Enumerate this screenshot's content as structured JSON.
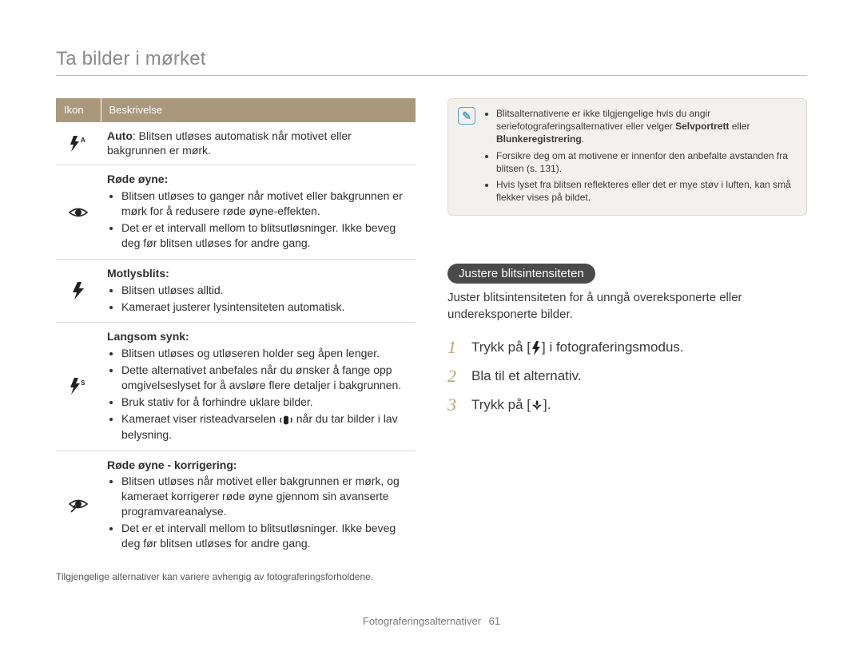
{
  "page_title": "Ta bilder i mørket",
  "table": {
    "head": {
      "icon": "Ikon",
      "desc": "Beskrivelse"
    },
    "rows": [
      {
        "icon_name": "flash-auto-icon",
        "title_bold": "Auto",
        "title_rest": ": Blitsen utløses automatisk når motivet eller bakgrunnen er mørk."
      },
      {
        "icon_name": "red-eye-icon",
        "title": "Røde øyne:",
        "bullets": [
          "Blitsen utløses to ganger når motivet eller bakgrunnen er mørk for å redusere røde øyne-effekten.",
          "Det er et intervall mellom to blitsutløsninger. Ikke beveg deg før blitsen utløses for andre gang."
        ]
      },
      {
        "icon_name": "fill-flash-icon",
        "title": "Motlysblits:",
        "bullets": [
          "Blitsen utløses alltid.",
          "Kameraet justerer lysintensiteten automatisk."
        ]
      },
      {
        "icon_name": "slow-sync-icon",
        "title": "Langsom synk:",
        "bullets": [
          "Blitsen utløses og utløseren holder seg åpen lenger.",
          "Dette alternativet anbefales når du ønsker å fange opp omgivelseslyset for å avsløre flere detaljer i bakgrunnen.",
          "Bruk stativ for å forhindre uklare bilder.",
          "Kameraet viser risteadvarselen   når du tar bilder i lav belysning."
        ],
        "shake_icon": "shake-warning-icon"
      },
      {
        "icon_name": "red-eye-fix-icon",
        "title": "Røde øyne - korrigering:",
        "bullets": [
          "Blitsen utløses når motivet eller bakgrunnen er mørk, og kameraet korrigerer røde øyne gjennom sin avanserte programvareanalyse.",
          "Det er et intervall mellom to blitsutløsninger. Ikke beveg deg før blitsen utløses for andre gang."
        ]
      }
    ]
  },
  "footnote": "Tilgjengelige alternativer kan variere avhengig av fotograferingsforholdene.",
  "note": {
    "bullets": [
      {
        "pre": "Blitsalternativene er ikke tilgjengelige hvis du angir seriefotograferingsalternativer eller velger ",
        "b1": "Selvportrett",
        "mid": " eller ",
        "b2": "Blunkeregistrering",
        "post": "."
      },
      {
        "text": "Forsikre deg om at motivene er innenfor den anbefalte avstanden fra blitsen (s. 131)."
      },
      {
        "text": "Hvis lyset fra blitsen reflekteres eller det er mye støv i luften, kan små flekker vises på bildet."
      }
    ]
  },
  "section": {
    "pill": "Justere blitsintensiteten",
    "desc": "Juster blitsintensiteten for å unngå overeksponerte eller undereksponerte bilder."
  },
  "steps": [
    {
      "n": "1",
      "pre": "Trykk på [",
      "icon": "flash-icon",
      "post": "] i fotograferingsmodus."
    },
    {
      "n": "2",
      "text": "Bla til et alternativ."
    },
    {
      "n": "3",
      "pre": "Trykk på [",
      "icon": "macro-icon",
      "post": "]."
    }
  ],
  "footer": {
    "section": "Fotograferingsalternativer",
    "page": "61"
  }
}
